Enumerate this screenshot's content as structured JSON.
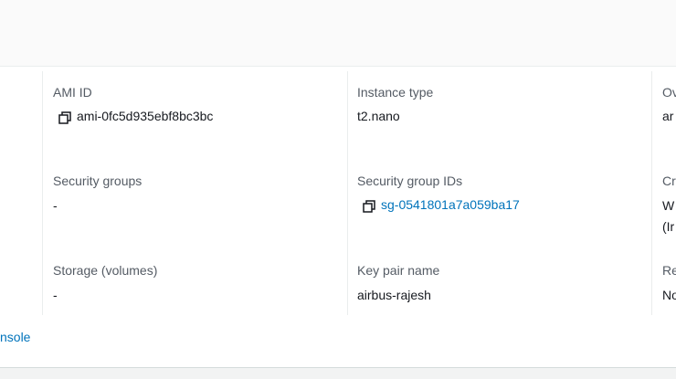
{
  "details": {
    "col1": {
      "ami_label": "AMI ID",
      "ami_value": "ami-0fc5d935ebf8bc3bc",
      "sg_label": "Security groups",
      "sg_value": "-",
      "storage_label": "Storage (volumes)",
      "storage_value": "-"
    },
    "col2": {
      "type_label": "Instance type",
      "type_value": "t2.nano",
      "sgid_label": "Security group IDs",
      "sgid_value": "sg-0541801a7a059ba17",
      "keypair_label": "Key pair name",
      "keypair_value": "airbus-rajesh"
    },
    "col3": {
      "row1_label": "Ov",
      "row1_value": "ar",
      "row2_label": "Cr",
      "row2_value_line1": "W",
      "row2_value_line2": "(Ir",
      "row3_label": "Re",
      "row3_value": "No"
    }
  },
  "footer": {
    "console_link": "nsole"
  },
  "colors": {
    "link": "#0073bb",
    "label": "#545b64",
    "text": "#16191f",
    "divider": "#eaeded"
  },
  "icons": [
    "copy-icon"
  ]
}
